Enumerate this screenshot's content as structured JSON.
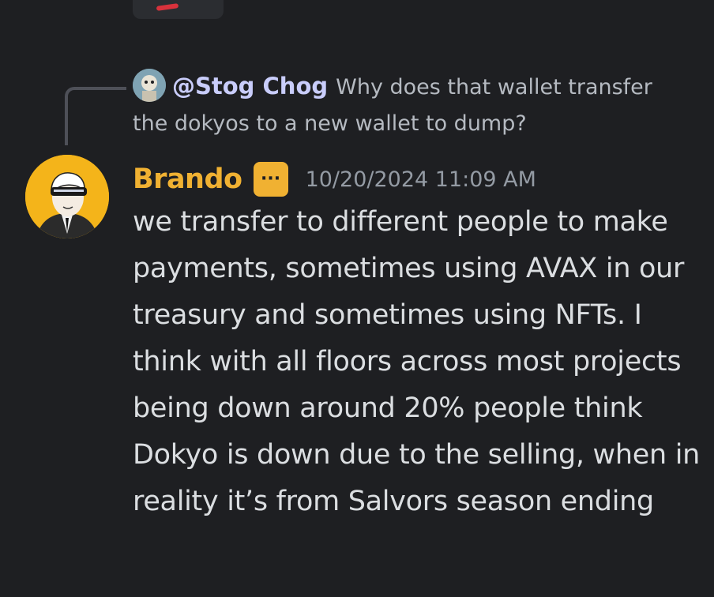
{
  "reply": {
    "mention": "@Stog Chog",
    "text": "Why does that wallet transfer the dokyos to a new wallet to dump?",
    "avatar_icon": "stog-chog-avatar"
  },
  "message": {
    "author": "Brando",
    "author_color": "#f0b132",
    "badge": "···",
    "timestamp": "10/20/2024 11:09 AM",
    "avatar_icon": "brando-avatar",
    "content": "we transfer to different people to make payments, sometimes using AVAX in our treasury and sometimes using NFTs. I think with all floors across most projects being down around 20% people think Dokyo is down due to the selling, when in reality it’s from Salvors season ending"
  },
  "theme": {
    "background": "#1e1f22",
    "text": "#dbdee1",
    "muted": "#949ba4",
    "mention": "#c9cdfb"
  }
}
